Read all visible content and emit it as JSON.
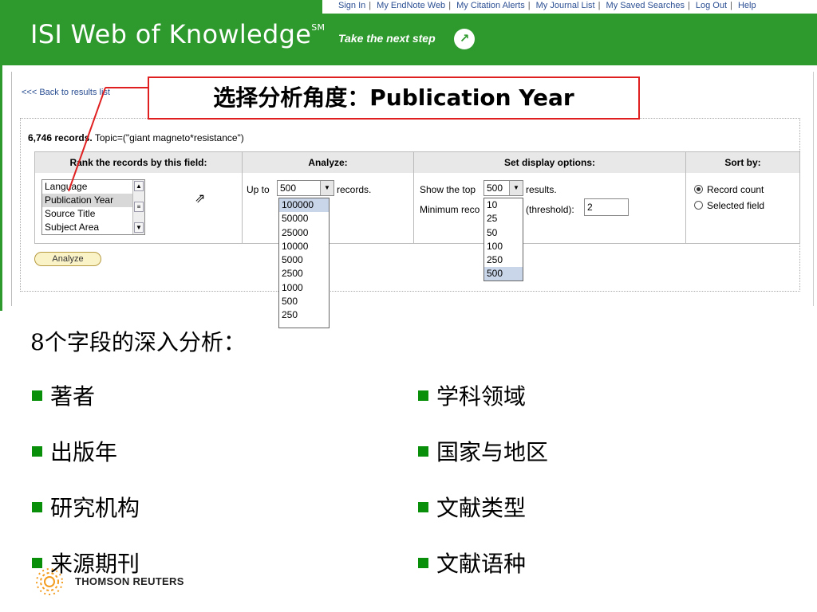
{
  "header": {
    "top_links": [
      "Sign In",
      "My EndNote Web",
      "My Citation Alerts",
      "My Journal List",
      "My Saved Searches",
      "Log Out",
      "Help"
    ],
    "logo": "ISI Web of Knowledge",
    "logo_mark": "SM",
    "tagline": "Take the next step",
    "brand_color": "#2e9a2e"
  },
  "screenshot": {
    "back_link": "<<< Back to results list",
    "records_count": "6,746 records.",
    "records_query": "Topic=(\"giant magneto*resistance\")",
    "columns": [
      "Rank the records by this field:",
      "Analyze:",
      "Set display options:",
      "Sort by:"
    ],
    "rank_fields": [
      "Language",
      "Publication Year",
      "Source Title",
      "Subject Area"
    ],
    "rank_selected": "Publication Year",
    "analyze": {
      "prefix": "Up to",
      "value": "500",
      "suffix": "records.",
      "options": [
        "100000",
        "50000",
        "25000",
        "10000",
        "5000",
        "2500",
        "1000",
        "500",
        "250"
      ]
    },
    "display": {
      "show_prefix": "Show the top",
      "show_value": "500",
      "show_suffix": "results.",
      "min_prefix": "Minimum reco",
      "min_suffix": "(threshold):",
      "threshold": "2",
      "options": [
        "10",
        "25",
        "50",
        "100",
        "250",
        "500"
      ]
    },
    "sort": {
      "options": [
        "Record count",
        "Selected field"
      ],
      "selected": "Record count"
    },
    "analyze_button": "Analyze"
  },
  "callout": {
    "text": "选择分析角度：Publication Year",
    "color": "#e02020"
  },
  "slide": {
    "heading": "8个字段的深入分析：",
    "left_items": [
      "著者",
      "出版年",
      "研究机构",
      "来源期刊"
    ],
    "right_items": [
      "学科领域",
      "国家与地区",
      "文献类型",
      "文献语种"
    ],
    "bullet_color": "#0a8f0a",
    "footer_logo": "THOMSON REUTERS"
  }
}
